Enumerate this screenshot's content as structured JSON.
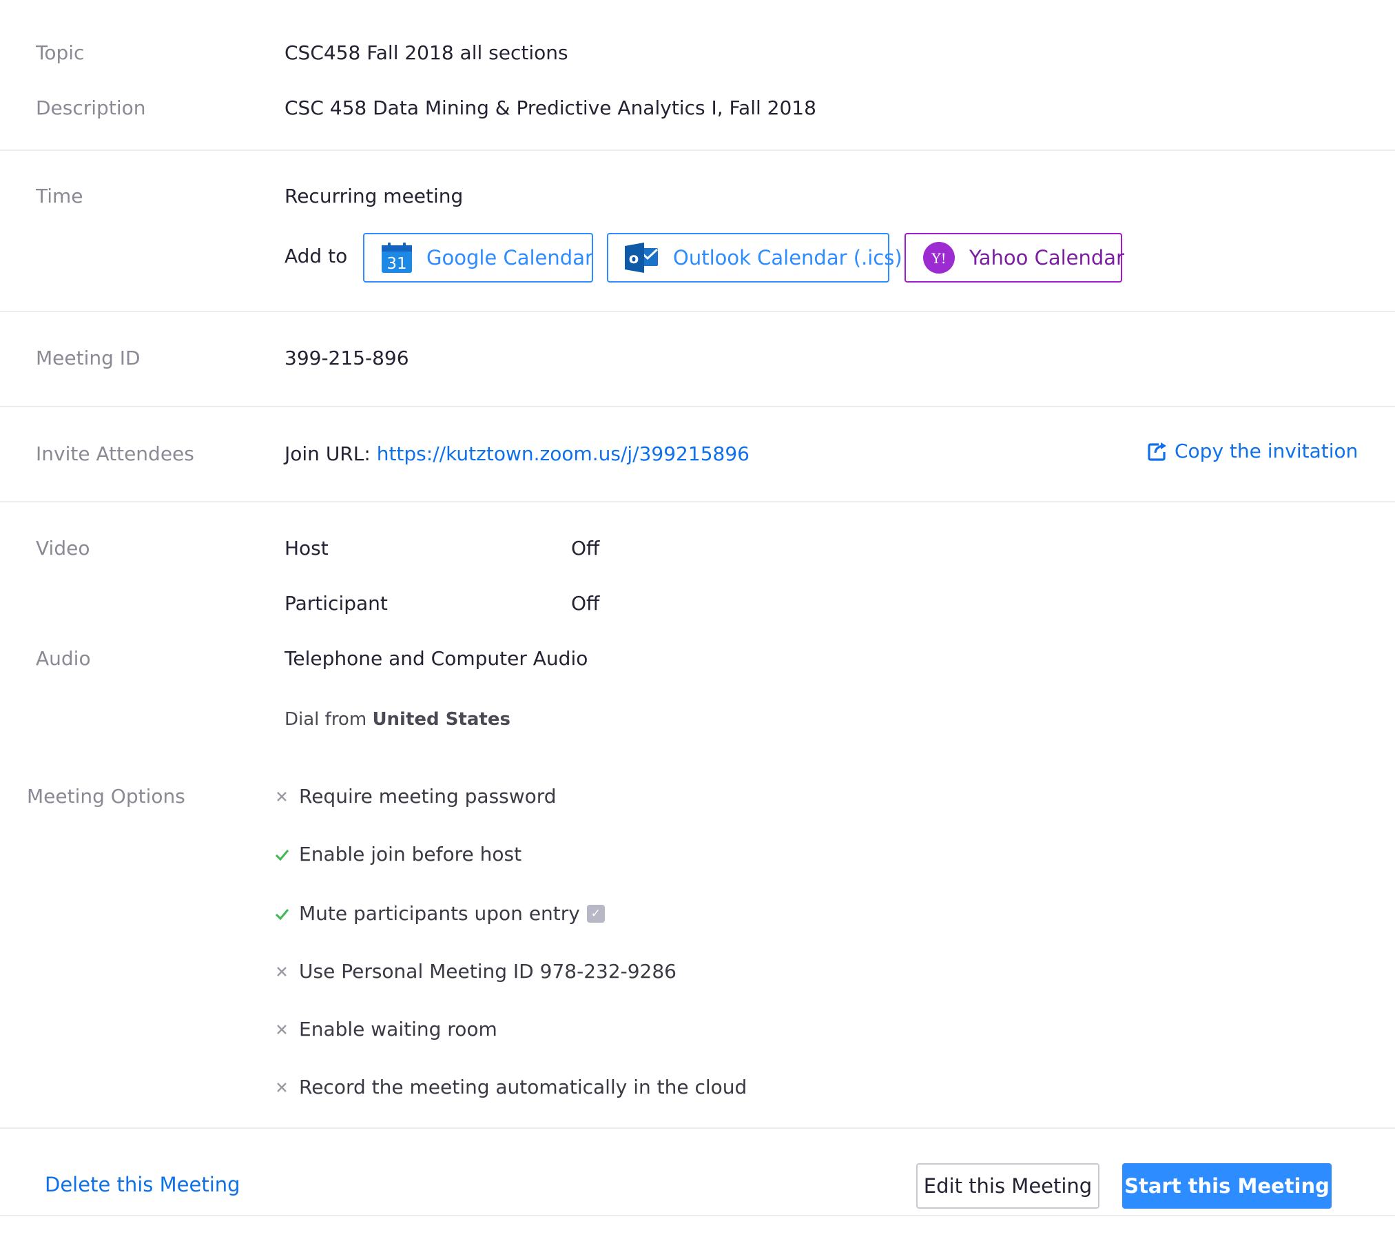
{
  "topic": {
    "label": "Topic",
    "value": "CSC458 Fall 2018 all sections"
  },
  "description": {
    "label": "Description",
    "value": "CSC 458 Data Mining & Predictive Analytics I, Fall 2018"
  },
  "time": {
    "label": "Time",
    "value": "Recurring meeting",
    "add_to_label": "Add to",
    "calendars": {
      "google": {
        "label": "Google Calendar",
        "icon": "google-calendar-icon",
        "icon_text": "31"
      },
      "outlook": {
        "label": "Outlook Calendar (.ics)",
        "icon": "outlook-icon",
        "icon_text": "o"
      },
      "yahoo": {
        "label": "Yahoo Calendar",
        "icon": "yahoo-icon",
        "icon_text": "Y!"
      }
    }
  },
  "meeting_id": {
    "label": "Meeting ID",
    "value": "399-215-896"
  },
  "invite": {
    "label": "Invite Attendees",
    "join_label": "Join URL:",
    "join_url": "https://kutztown.zoom.us/j/399215896",
    "copy_label": "Copy the invitation"
  },
  "video": {
    "label": "Video",
    "host_label": "Host",
    "host_value": "Off",
    "participant_label": "Participant",
    "participant_value": "Off"
  },
  "audio": {
    "label": "Audio",
    "value": "Telephone and Computer Audio",
    "dial_prefix": "Dial from",
    "dial_country": "United States"
  },
  "meeting_options": {
    "label": "Meeting Options",
    "items": [
      {
        "label": "Require meeting password",
        "enabled": false
      },
      {
        "label": "Enable join before host",
        "enabled": true
      },
      {
        "label": "Mute participants upon entry",
        "enabled": true,
        "badge_text": "✓"
      },
      {
        "label": "Use Personal Meeting ID 978-232-9286",
        "enabled": false
      },
      {
        "label": "Enable waiting room",
        "enabled": false
      },
      {
        "label": "Record the meeting automatically in the cloud",
        "enabled": false
      }
    ]
  },
  "footer": {
    "delete_label": "Delete this Meeting",
    "edit_label": "Edit this Meeting",
    "start_label": "Start this Meeting"
  },
  "colors": {
    "accent": "#2d8cff",
    "link": "#0e71eb",
    "yahoo_purple": "#a11bd0",
    "check_green": "#3fb950",
    "cross_gray": "#9a9aa5"
  }
}
